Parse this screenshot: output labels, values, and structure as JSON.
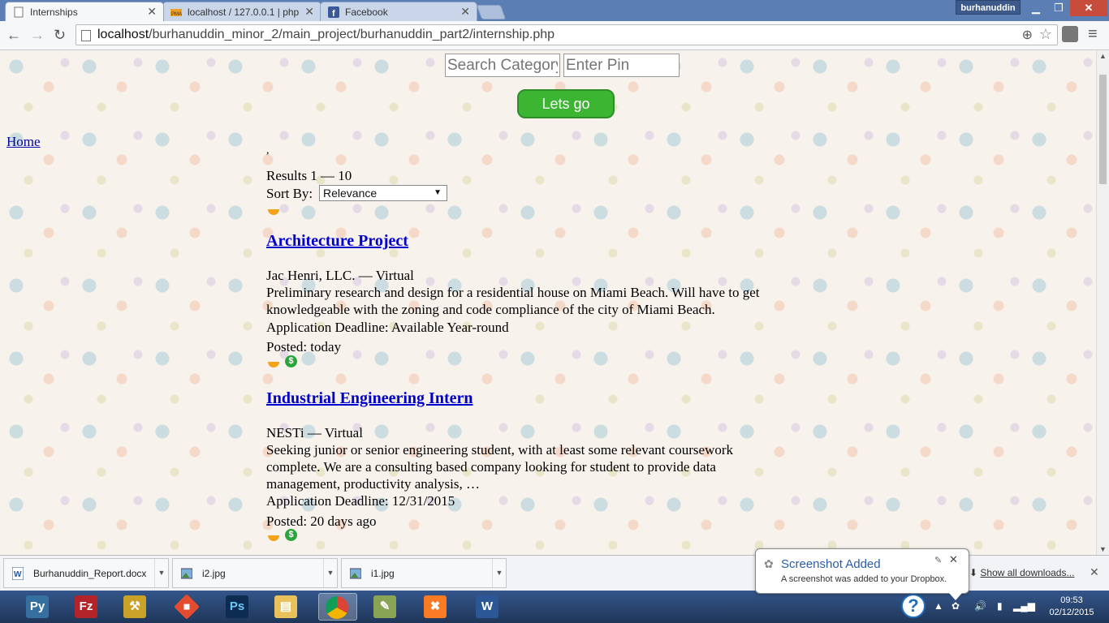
{
  "browser": {
    "tabs": [
      {
        "label": "Internships",
        "favicon": "page-icon"
      },
      {
        "label": "localhost / 127.0.0.1 | php",
        "favicon": "phpmyadmin-icon"
      },
      {
        "label": "Facebook",
        "favicon": "facebook-icon"
      }
    ],
    "user": "burhanuddin",
    "url_host": "localhost",
    "url_path": "/burhanuddin_minor_2/main_project/burhanuddin_part2/internship.php"
  },
  "search": {
    "category_placeholder": "Search Category",
    "pin_placeholder": "Enter Pin",
    "go_label": "Lets go"
  },
  "page": {
    "home_link": "Home",
    "comma": ",",
    "results_text": "Results 1 — 10",
    "sort_label": "Sort By:",
    "sort_value": "Relevance"
  },
  "listings": [
    {
      "title": "Architecture Project",
      "company": "Jac Henri, LLC. — Virtual",
      "description": "Preliminary research and design for a residential house on Miami Beach. Will have to get knowledgeable with the zoning and code compliance of the city of Miami Beach.",
      "deadline": "Application Deadline: Available Year-round",
      "posted": "Posted: today",
      "paid_badge": "$"
    },
    {
      "title": "Industrial Engineering Intern",
      "company": "NESTi — Virtual",
      "description": "Seeking junior or senior engineering student, with at least some relevant coursework complete. We are a consulting based company looking for student to provide data management, productivity analysis, …",
      "deadline": "Application Deadline: 12/31/2015",
      "posted": "Posted: 20 days ago",
      "paid_badge": "$"
    }
  ],
  "downloads": {
    "items": [
      {
        "name": "Burhanuddin_Report.docx",
        "icon": "word-doc-icon"
      },
      {
        "name": "i2.jpg",
        "icon": "image-icon"
      },
      {
        "name": "i1.jpg",
        "icon": "image-icon"
      }
    ],
    "show_all": "Show all downloads..."
  },
  "notification": {
    "title": "Screenshot Added",
    "body": "A screenshot was added to your Dropbox."
  },
  "taskbar": {
    "apps": [
      "python-icon",
      "filezilla-icon",
      "tools-icon",
      "git-icon",
      "photoshop-icon",
      "file-explorer-icon",
      "chrome-icon",
      "notepad-icon",
      "xampp-icon",
      "word-icon"
    ],
    "time": "09:53",
    "date": "02/12/2015"
  },
  "colors": {
    "go_button": "#3cb532",
    "link": "#0000cc",
    "paid_badge": "#27a73a",
    "time_badge": "#f3a21a"
  }
}
